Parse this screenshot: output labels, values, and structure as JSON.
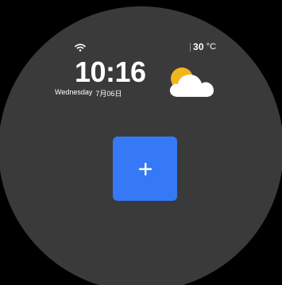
{
  "status_bar": {
    "wifi_icon": "wifi-icon",
    "temperature_value": "30",
    "temperature_unit": "°C"
  },
  "clock": {
    "time": "10:16",
    "weekday": "Wednesday",
    "date": "7月06日"
  },
  "weather": {
    "icon": "partly-cloudy-icon"
  },
  "actions": {
    "add_icon": "plus-icon"
  },
  "colors": {
    "face_background": "#3a3a3a",
    "accent_blue": "#3579f6",
    "sun_yellow": "#f3b51e",
    "cloud_white": "#ffffff"
  }
}
